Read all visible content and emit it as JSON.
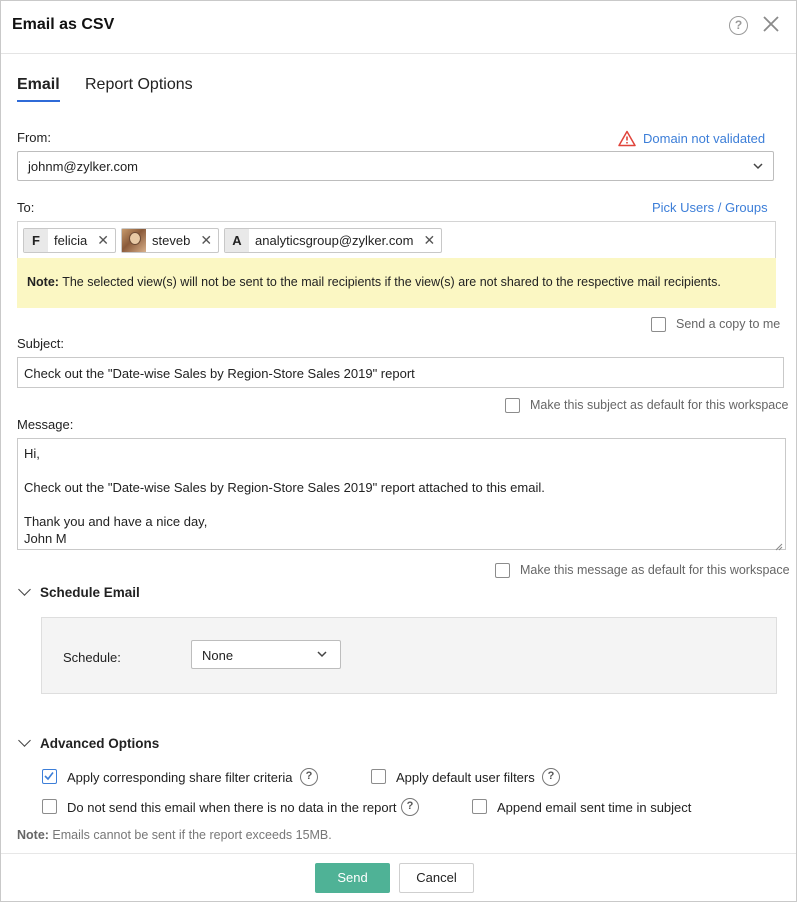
{
  "dialog": {
    "title": "Email as CSV",
    "help_icon": "question-circle-icon",
    "close_icon": "close-icon"
  },
  "tabs": [
    {
      "label": "Email",
      "active": true
    },
    {
      "label": "Report Options",
      "active": false
    }
  ],
  "from": {
    "label": "From:",
    "warning_icon": "warning-triangle-icon",
    "warning_text": "Domain not validated",
    "value": "johnm@zylker.com"
  },
  "to": {
    "label": "To:",
    "pick_link": "Pick Users / Groups",
    "recipients": [
      {
        "initial": "F",
        "name": "felicia"
      },
      {
        "initial": "",
        "name": "steveb",
        "avatar": "user-avatar"
      },
      {
        "initial": "A",
        "name": "analyticsgroup@zylker.com"
      }
    ]
  },
  "note": {
    "prefix": "Note:",
    "text": " The selected view(s) will not be sent to the mail recipients if the view(s) are not shared to the respective mail recipients."
  },
  "send_copy": {
    "label": "Send a copy to me",
    "checked": false
  },
  "subject": {
    "label": "Subject:",
    "value": "Check out the \"Date-wise Sales by Region-Store Sales 2019\" report",
    "default_label": "Make this subject as default for this workspace",
    "default_checked": false
  },
  "message": {
    "label": "Message:",
    "lines": [
      "Hi,",
      "",
      "Check out the \"Date-wise Sales by Region-Store Sales 2019\" report attached to this email.",
      "",
      "Thank you and have a nice day,",
      "John M"
    ],
    "default_label": "Make this message as default for this workspace",
    "default_checked": false
  },
  "schedule": {
    "section_title": "Schedule Email",
    "label": "Schedule:",
    "value": "None"
  },
  "advanced": {
    "section_title": "Advanced Options",
    "options": [
      {
        "label": "Apply corresponding share filter criteria",
        "checked": true,
        "help": true
      },
      {
        "label": "Apply default user filters",
        "checked": false,
        "help": true
      },
      {
        "label": "Do not send this email when there is no data in the report",
        "checked": false,
        "help": true
      },
      {
        "label": "Append email sent time in subject",
        "checked": false,
        "help": false
      }
    ]
  },
  "footer_note": {
    "prefix": "Note:",
    "text": " Emails cannot be sent if the report exceeds 15MB."
  },
  "buttons": {
    "send": "Send",
    "cancel": "Cancel"
  },
  "colors": {
    "accent": "#3c7ed8",
    "send_button": "#4fb296",
    "note_bg": "#fbf7c3",
    "warning": "#e0443b"
  }
}
